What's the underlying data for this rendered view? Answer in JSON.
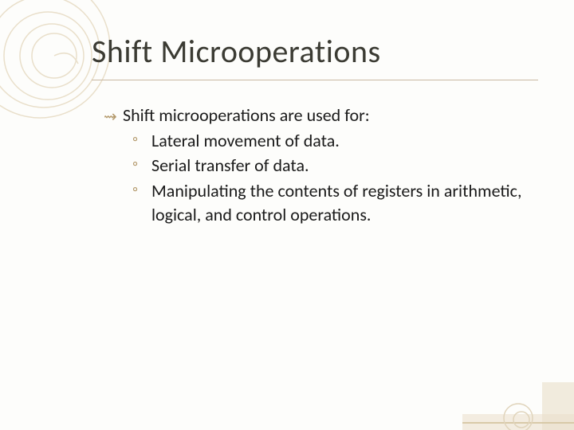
{
  "title": "Shift  Microoperations",
  "intro": "Shift microoperations are used for:",
  "points": [
    "Lateral movement of data.",
    "Serial transfer of data.",
    "Manipulating the contents of registers in arithmetic,  logical, and control operations."
  ],
  "bullets": {
    "lvl1": "⇝",
    "lvl2": "◦"
  }
}
